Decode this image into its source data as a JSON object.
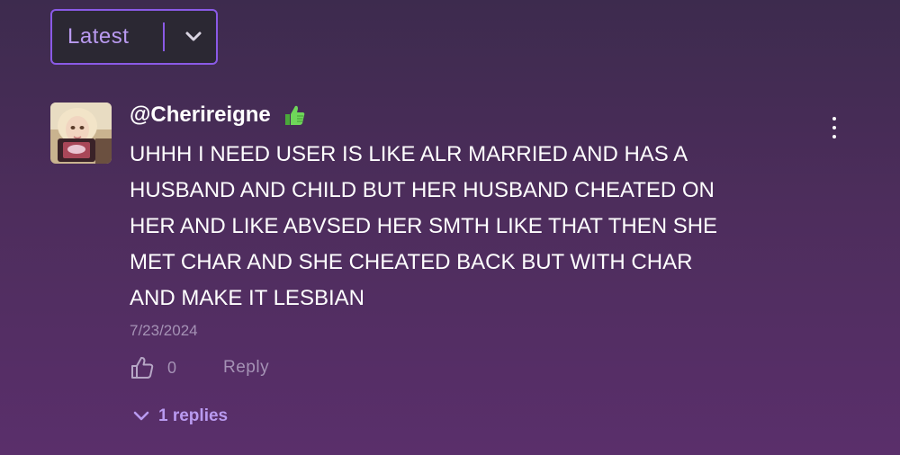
{
  "sort": {
    "label": "Latest"
  },
  "comment": {
    "username": "@Cherireigne",
    "badge_icon": "thumbs-up-icon",
    "text_lines": [
      "UHHH I NEED USER IS LIKE ALR MARRIED AND HAS A",
      "HUSBAND AND CHILD BUT HER HUSBAND CHEATED ON",
      "HER AND LIKE ABVSED HER SMTH LIKE THAT THEN SHE",
      "MET CHAR AND SHE CHEATED BACK BUT WITH CHAR",
      "AND MAKE IT LESBIAN"
    ],
    "date": "7/23/2024",
    "likes": "0",
    "reply_label": "Reply",
    "replies_label": "1 replies"
  },
  "colors": {
    "accent": "#8a5ae6",
    "accent_text": "#b99af0",
    "muted_text": "#a592b5",
    "badge_green": "#5fc84a"
  }
}
